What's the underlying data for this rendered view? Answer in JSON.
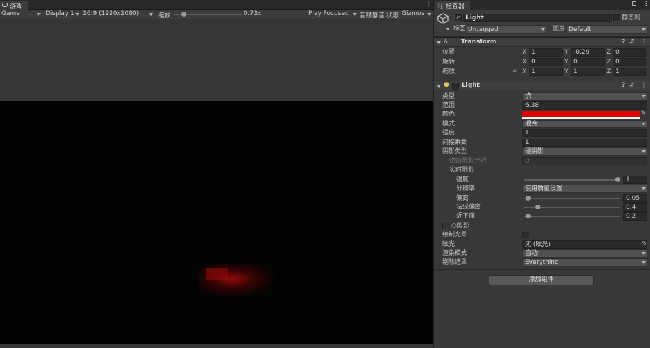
{
  "game_panel": {
    "tab_label": "游戏",
    "mode": "Game",
    "display": "Display 1",
    "aspect": "16:9 (1920x1080)",
    "scale_label": "缩放",
    "scale_value": "0.73x",
    "scale_fraction": 0.12,
    "play_mode": "Play Focused",
    "mute_label": "音频静音",
    "stats_label": "状态",
    "gizmos_label": "Gizmos"
  },
  "inspector": {
    "tab_label": "检查器",
    "object_name": "Light",
    "active": true,
    "static_label": "静态的",
    "tag_label": "标签",
    "tag_value": "Untagged",
    "layer_label": "图层",
    "layer_value": "Default",
    "transform": {
      "title": "Transform",
      "rows": [
        {
          "label": "位置",
          "x": "1",
          "y": "-0.29",
          "z": "0"
        },
        {
          "label": "旋转",
          "x": "0",
          "y": "0",
          "z": "0"
        },
        {
          "label": "缩放",
          "x": "1",
          "y": "1",
          "z": "1"
        }
      ],
      "axis_x": "X",
      "axis_y": "Y",
      "axis_z": "Z"
    },
    "light": {
      "title": "Light",
      "type_label": "类型",
      "type_value": "点",
      "range_label": "范围",
      "range_value": "6.38",
      "color_label": "颜色",
      "color_value": "#e00000",
      "mode_label": "模式",
      "mode_value": "混合",
      "intensity_label": "强度",
      "intensity_value": "1",
      "indirect_label": "间接乘数",
      "indirect_value": "1",
      "shadow_type_label": "阴影类型",
      "shadow_type_value": "硬阴影",
      "baked_radius_label": "烘焙阴影半径",
      "baked_radius_value": "0",
      "realtime_label": "实时阴影",
      "strength_label": "强度",
      "strength_value": "1",
      "strength_fraction": 1.0,
      "resolution_label": "分辨率",
      "resolution_value": "使用质量设置",
      "bias_label": "偏离",
      "bias_value": "0.05",
      "bias_fraction": 0.025,
      "normal_bias_label": "法线偏离",
      "normal_bias_value": "0.4",
      "normal_bias_fraction": 0.13,
      "near_plane_label": "近平面",
      "near_plane_value": "0.2",
      "near_plane_fraction": 0.02,
      "cookie_label": "○剪影",
      "halo_label": "绘制光晕",
      "flare_label": "眩光",
      "flare_value": "无 (眩光)",
      "render_mode_label": "渲染模式",
      "render_mode_value": "自动",
      "culling_label": "剔除遮罩",
      "culling_value": "Everything"
    },
    "add_component_label": "添加组件"
  }
}
